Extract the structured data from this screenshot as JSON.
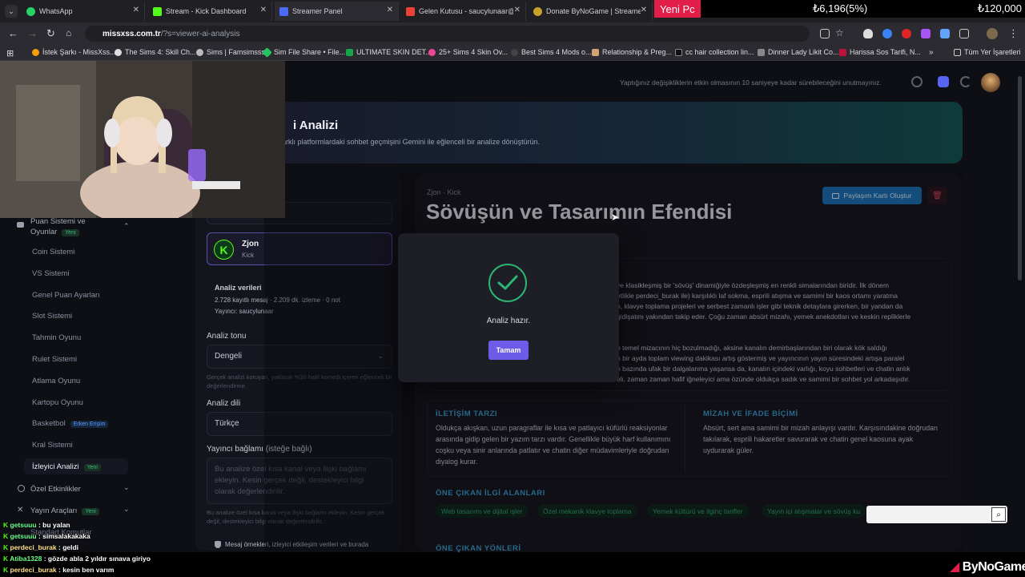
{
  "tabs": [
    {
      "label": "WhatsApp",
      "color": "#25d366"
    },
    {
      "label": "Stream - Kick Dashboard",
      "color": "#53fc18"
    },
    {
      "label": "Streamer Panel",
      "color": "#4a6cf7"
    },
    {
      "label": "Gelen Kutusu - saucylunaar@g",
      "color": "#ea4335"
    },
    {
      "label": "Donate ByNoGame | Streamer",
      "color": "#c9a227"
    }
  ],
  "ticker": {
    "label": "Yeni Pc",
    "amount": "₺6,196(5%)",
    "goal": "₺120,000"
  },
  "address": {
    "site": "missxss.com.tr",
    "path": "/?s=viewer-ai-analysis"
  },
  "bookmarks": [
    "İstek Şarkı - MissXss...",
    "The Sims 4: Skill Ch...",
    "Sims | Famsimsss",
    "Sim File Share • File...",
    "ULTIMATE SKIN DET...",
    "25+ Sims 4 Skin Ov...",
    "Best Sims 4 Mods o...",
    "Relationship & Preg...",
    "cc hair collection lin...",
    "Dinner Lady Likit Co...",
    "Harissa Sos Tarifi, N...",
    "Tüm Yer İşaretleri"
  ],
  "notice": "Yaptığınız değişikliklerin etkin olmasının 10 saniyeye kadar sürebileceğini unutmayınız.",
  "banner": {
    "title": "i Analizi",
    "subtitle": "in farklı platformlardaki sohbet geçmişini Gemini ile eğlenceli bir analize dönüştürün."
  },
  "sidebar": {
    "group1": "Puan Sistemi ve Oyunlar",
    "group1_badge": "Yeni",
    "items": [
      "Coin Sistemi",
      "VS Sistemi",
      "Genel Puan Ayarları",
      "Slot Sistemi",
      "Tahmin Oyunu",
      "Rulet Sistemi",
      "Atlama Oyunu",
      "Kartopu Oyunu",
      "Basketbol",
      "Kral Sistemi",
      "İzleyici Analizi"
    ],
    "basketbol_badge": "Erken Erişim",
    "active_badge": "Yeni",
    "group2": "Özel Etkinlikler",
    "group3": "Yayın Araçları",
    "group3_badge": "Yeni",
    "group4": "Standart Komutlar"
  },
  "form": {
    "channel_name": "Zjon",
    "channel_platform": "Kick",
    "data_title": "Analiz verileri",
    "data_stats": "2.728 kayıtlı mesaj · 2.209 dk. izleme · 0 not",
    "data_streamer": "Yayıncı: saucylunaar",
    "tone_label": "Analiz tonu",
    "tone_value": "Dengeli",
    "tone_hint": "Gerçek analizi koruyan, yaklaşık %30 hafif komedi içeren eğlenceli bir değerlendirme.",
    "lang_label": "Analiz dili",
    "lang_value": "Türkçe",
    "ctx_label": "Yayıncı bağlamı (isteğe bağlı)",
    "ctx_placeholder": "Bu analize özel kısa kanal veya ilişki bağlamı ekleyin. Kesin gerçek değil, destekleyici bilgi olarak değerlendirilir.",
    "ctx_hint": "Bu analize özel kısa kanal veya ilişki bağlamı ekleyin. Kesin gerçek değil, destekleyici bilgi olarak değerlendirilir.",
    "privacy": "Mesaj örnekleri, izleyici etkileşim verileri ve burada"
  },
  "result": {
    "meta": "Zjon · Kick",
    "title": "Sövüşün ve Tasarımın Efendisi",
    "share_label": "Paylaşım Kartı Oluştur",
    "para1": [
      "ve klasikleşmiş bir 'sövüş' dinamiğiyle özdeşleşmiş en renkli simalarından biridir. İlk dönem",
      "etlikle perdeci_burak ile) karşılıklı laf sokma, esprili atışma ve samimi bir kaos ortamı yaratma",
      "n, klavye toplama projeleri ve serbest zamanlı işler gibi teknik detaylara girerken, bir yandan da",
      "gidişatını yakından takip eder. Çoğu zaman absürt mizahı, yemek anekdotları ve keskin repliklerle"
    ],
    "para2": [
      "n temel mizacının hiç bozulmadığı, aksine kanalın demirbaşlarından biri olarak kök saldığı",
      "n bir ayda toplam viewing dakikası artış göstermiş ve yayıncının yayın süresindeki artışa paralel",
      "n bazında ufak bir dalgalanma yaşansa da, kanalın içindeki varlığı, koyu sohbetleri ve chatin anlık",
      "eli, zaman zaman hafif iğneleyici ama özünde oldukça sadık ve samimi bir sohbet yol arkadaşıdır."
    ],
    "sec1_title": "İLETİŞİM TARZI",
    "sec1_text": "Oldukça akışkan, uzun paragraflar ile kısa ve patlayıcı küfürlü reaksiyonlar arasında gidip gelen bir yazım tarzı vardır. Genellikle büyük harf kullanımını coşku veya sinir anlarında patlatır ve chatin diğer müdavimleriyle doğrudan diyalog kurar.",
    "sec2_title": "MİZAH VE İFADE BİÇİMİ",
    "sec2_text": "Absürt, sert ama samimi bir mizah anlayışı vardır. Karşısındakine doğrudan takılarak, esprili hakaretler savurarak ve chatin genel kaosuna ayak uydurarak güler.",
    "sec3_title": "ÖNE ÇIKAN İLGİ ALANLARI",
    "chips": [
      "Web tasarımı ve dijital işler",
      "Özel mekanik klavye toplama",
      "Yemek kültürü ve ilginç tarifler",
      "Yayın içi atışmalar ve sövüş ku"
    ],
    "sec4_title": "ÖNE ÇIKAN YÖNLERİ"
  },
  "modal": {
    "message": "Analiz hazır.",
    "ok": "Tamam"
  },
  "chat": [
    {
      "user": "getsuuu",
      "text": ": bu yalan"
    },
    {
      "user": "getsuuu",
      "text": ": simsalakakaka"
    },
    {
      "user": "perdeci_burak",
      "text": ": geldi"
    },
    {
      "user": "Atiba1328",
      "text": ": gözde abla 2 yıldır sınava giriyo"
    },
    {
      "user": "perdeci_burak",
      "text": ": kesin ben varım"
    }
  ],
  "brand": "ByNoGame"
}
